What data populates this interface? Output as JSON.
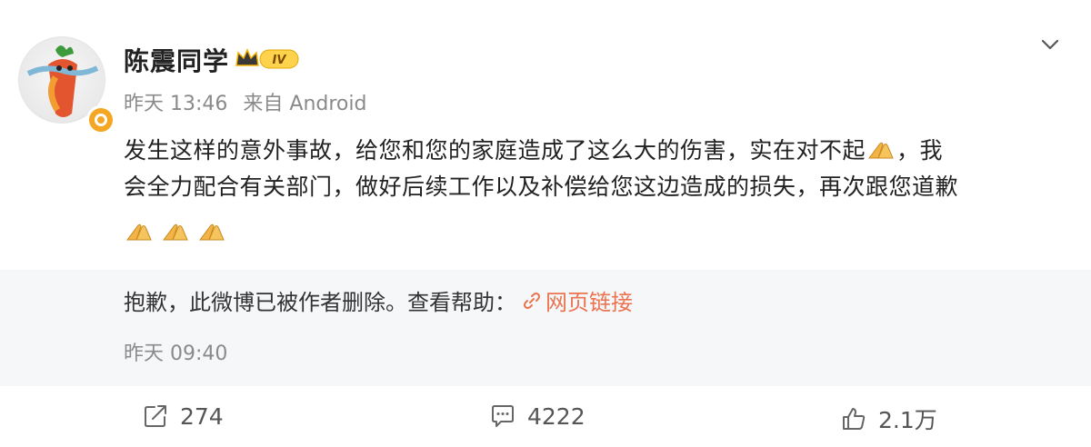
{
  "post": {
    "author": "陈震同学",
    "vip_badge": "IV",
    "time": "昨天 13:46",
    "source": "来自 Android",
    "text_line1": "发生这样的意外事故，给您和您的家庭造成了这么大的伤害，实在对不起",
    "text_line1_end": "，我",
    "text_line2": "会全力配合有关部门，做好后续工作以及补偿给您这边造成的损失，再次跟您道歉"
  },
  "repost": {
    "deleted_text": "抱歉，此微博已被作者删除。查看帮助：",
    "link_label": "网页链接",
    "time": "昨天 09:40"
  },
  "actions": {
    "repost_count": "274",
    "comment_count": "4222",
    "like_count": "2.1万"
  },
  "colors": {
    "accent": "#eb7350",
    "verify": "#f5a623",
    "repost_bg": "#f6f7f9"
  },
  "icons": [
    "avatar",
    "verified-badge-icon",
    "vip-crown-icon",
    "chevron-down-icon",
    "praying-hands-emoji",
    "link-icon",
    "repost-icon",
    "comment-icon",
    "like-icon"
  ]
}
